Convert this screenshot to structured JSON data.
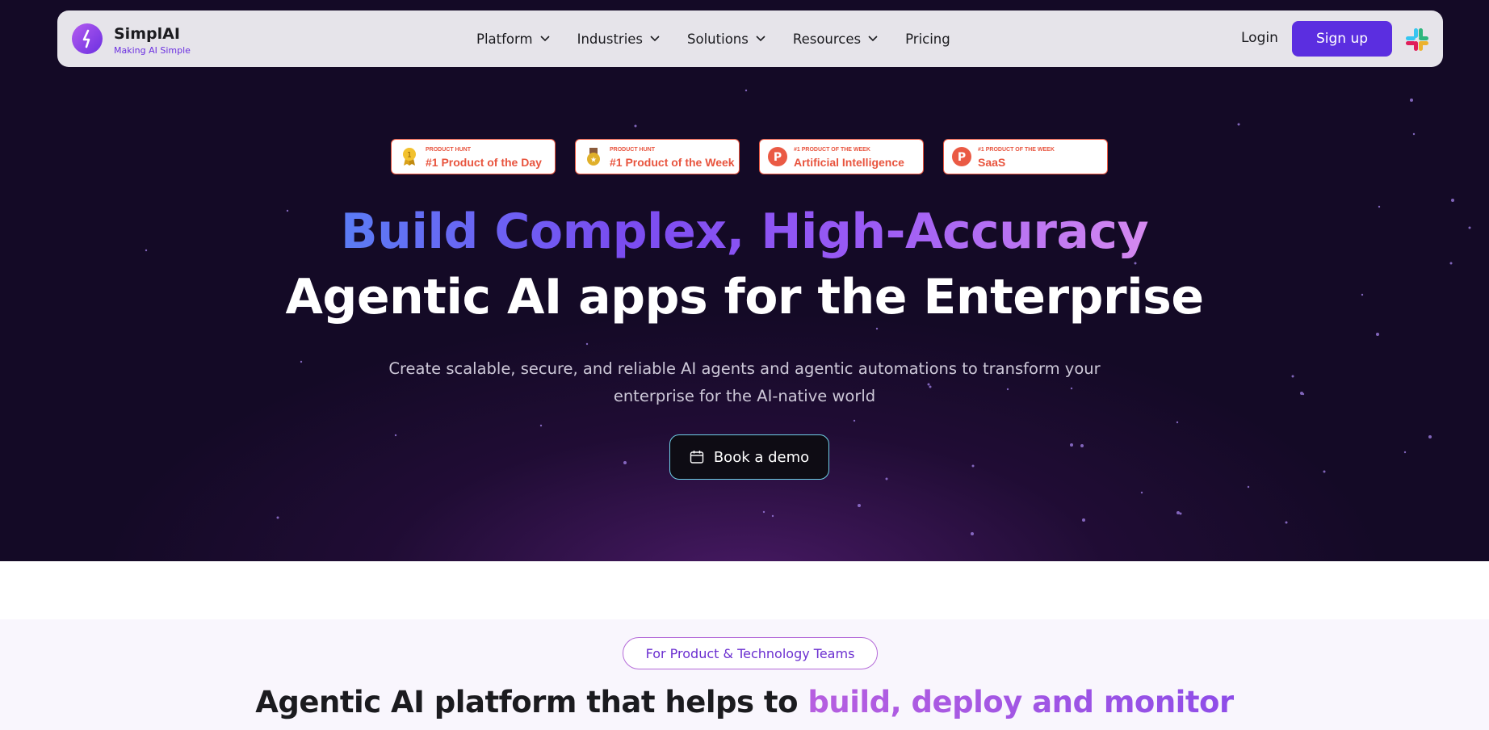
{
  "nav": {
    "brand_name": "SimplAI",
    "brand_tagline": "Making AI Simple",
    "menu": [
      {
        "label": "Platform"
      },
      {
        "label": "Industries"
      },
      {
        "label": "Solutions"
      },
      {
        "label": "Resources"
      },
      {
        "label": "Pricing"
      }
    ],
    "login_label": "Login",
    "signup_label": "Sign up"
  },
  "badges": [
    {
      "small": "PRODUCT HUNT",
      "main": "#1 Product of the Day",
      "icon": "gold-medal-icon"
    },
    {
      "small": "PRODUCT HUNT",
      "main": "#1 Product of the Week",
      "icon": "bronze-medal-icon"
    },
    {
      "small": "#1 PRODUCT OF THE WEEK",
      "main": "Artificial Intelligence",
      "icon": "product-hunt-logo-icon"
    },
    {
      "small": "#1 PRODUCT OF THE WEEK",
      "main": "SaaS",
      "icon": "product-hunt-logo-icon"
    }
  ],
  "hero": {
    "title_line1": "Build Complex, High-Accuracy",
    "title_line2": "Agentic AI apps for the Enterprise",
    "subtitle_line1": "Create scalable, secure, and reliable AI agents and agentic automations to transform your",
    "subtitle_line2": "enterprise for the AI-native world",
    "cta_label": "Book a demo"
  },
  "section2": {
    "pill_label": "For Product & Technology Teams",
    "heading_plain": "Agentic AI platform that helps to ",
    "heading_accent": "build, deploy and monitor"
  },
  "colors": {
    "hero_bg": "#140a26",
    "primary": "#5b2ee0",
    "badge_accent": "#e8543e"
  }
}
